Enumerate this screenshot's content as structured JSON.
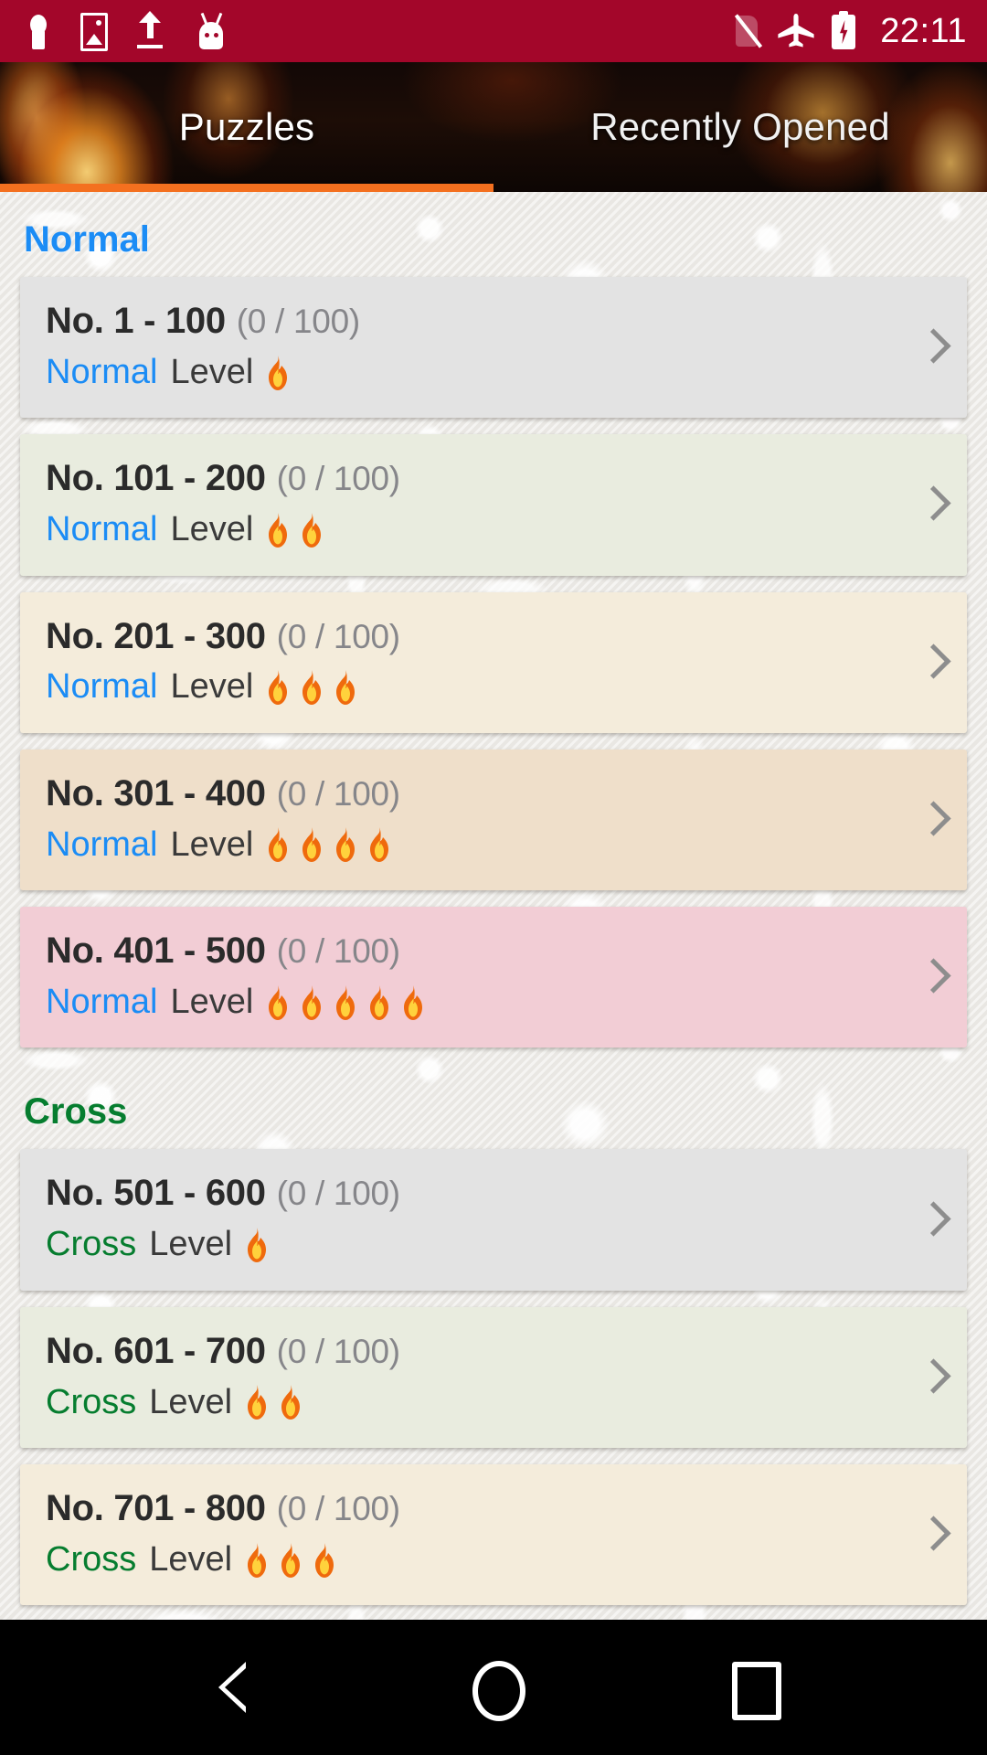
{
  "statusbar": {
    "time": "22:11",
    "icons": [
      {
        "name": "keyhole-icon"
      },
      {
        "name": "photo-icon"
      },
      {
        "name": "upload-icon"
      },
      {
        "name": "android-robot-icon"
      }
    ],
    "right_icons": [
      {
        "name": "no-sim-icon"
      },
      {
        "name": "airplane-mode-icon"
      },
      {
        "name": "battery-charging-icon"
      }
    ],
    "bg_color": "#A3062A"
  },
  "tabbar": {
    "tabs": [
      {
        "label": "Puzzles",
        "active": true
      },
      {
        "label": "Recently Opened",
        "active": false
      }
    ],
    "indicator_color": "#f4701f"
  },
  "sections": [
    {
      "title": "Normal",
      "color": "#1b8cf5",
      "items": [
        {
          "title": "No. 1 - 100",
          "count": "(0 / 100)",
          "mode": "Normal",
          "level_label": "Level",
          "flames": 1,
          "bg": "#e3e3e3"
        },
        {
          "title": "No. 101 - 200",
          "count": "(0 / 100)",
          "mode": "Normal",
          "level_label": "Level",
          "flames": 2,
          "bg": "#e9ecdf"
        },
        {
          "title": "No. 201 - 300",
          "count": "(0 / 100)",
          "mode": "Normal",
          "level_label": "Level",
          "flames": 3,
          "bg": "#f4ecdb"
        },
        {
          "title": "No. 301 - 400",
          "count": "(0 / 100)",
          "mode": "Normal",
          "level_label": "Level",
          "flames": 4,
          "bg": "#efdfca"
        },
        {
          "title": "No. 401 - 500",
          "count": "(0 / 100)",
          "mode": "Normal",
          "level_label": "Level",
          "flames": 5,
          "bg": "#f2cdd5"
        }
      ]
    },
    {
      "title": "Cross",
      "color": "#067d2f",
      "items": [
        {
          "title": "No. 501 - 600",
          "count": "(0 / 100)",
          "mode": "Cross",
          "level_label": "Level",
          "flames": 1,
          "bg": "#e3e3e3"
        },
        {
          "title": "No. 601 - 700",
          "count": "(0 / 100)",
          "mode": "Cross",
          "level_label": "Level",
          "flames": 2,
          "bg": "#e9ecdf"
        },
        {
          "title": "No. 701 - 800",
          "count": "(0 / 100)",
          "mode": "Cross",
          "level_label": "Level",
          "flames": 3,
          "bg": "#f4ecdb"
        }
      ]
    }
  ],
  "navbar": {
    "buttons": [
      {
        "name": "back-button"
      },
      {
        "name": "home-button"
      },
      {
        "name": "recents-button"
      }
    ]
  }
}
